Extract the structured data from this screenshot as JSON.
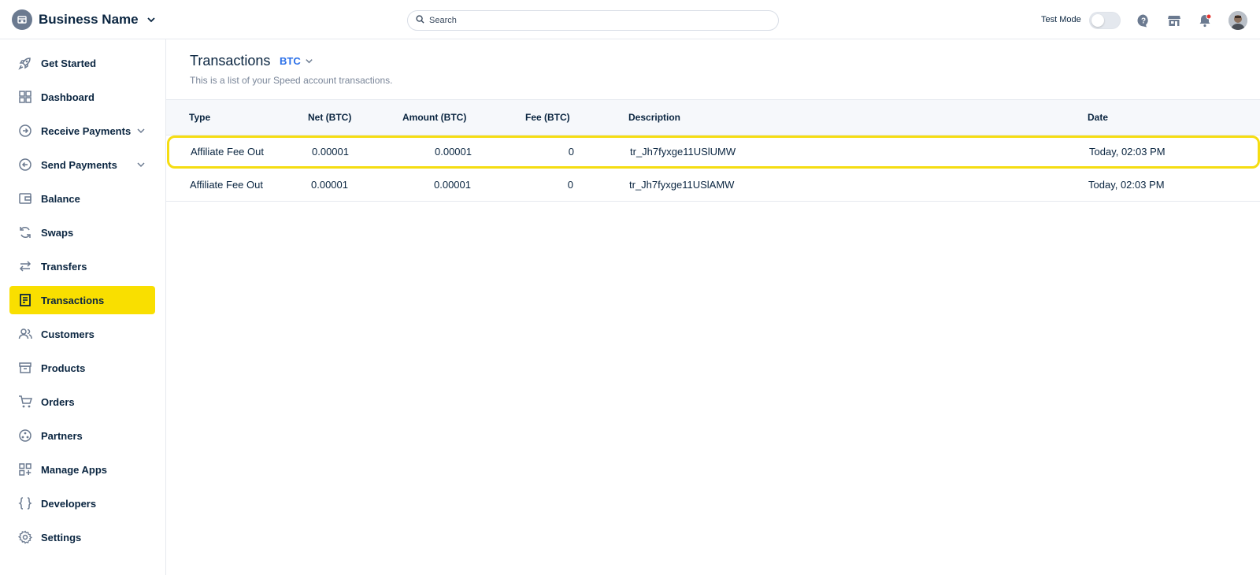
{
  "header": {
    "business_name": "Business Name",
    "search_placeholder": "Search",
    "test_mode_label": "Test Mode",
    "test_mode_on": false,
    "icons": [
      "help-icon",
      "store-icon",
      "notification-bell-icon"
    ]
  },
  "sidebar": {
    "items": [
      {
        "label": "Get Started",
        "icon": "rocket-icon"
      },
      {
        "label": "Dashboard",
        "icon": "grid-icon"
      },
      {
        "label": "Receive Payments",
        "icon": "receive-arrow-icon",
        "expandable": true
      },
      {
        "label": "Send Payments",
        "icon": "send-arrow-icon",
        "expandable": true
      },
      {
        "label": "Balance",
        "icon": "wallet-icon"
      },
      {
        "label": "Swaps",
        "icon": "swap-icon"
      },
      {
        "label": "Transfers",
        "icon": "transfer-arrows-icon"
      },
      {
        "label": "Transactions",
        "icon": "receipt-icon",
        "active": true
      },
      {
        "label": "Customers",
        "icon": "users-icon"
      },
      {
        "label": "Products",
        "icon": "archive-box-icon"
      },
      {
        "label": "Orders",
        "icon": "cart-icon"
      },
      {
        "label": "Partners",
        "icon": "partners-icon"
      },
      {
        "label": "Manage Apps",
        "icon": "apps-plus-icon"
      },
      {
        "label": "Developers",
        "icon": "code-braces-icon"
      },
      {
        "label": "Settings",
        "icon": "gear-icon"
      }
    ]
  },
  "main": {
    "title": "Transactions",
    "currency": "BTC",
    "subtitle": "This is a list of your Speed account transactions.",
    "table": {
      "columns": [
        "Type",
        "Net (BTC)",
        "Amount  (BTC)",
        "Fee  (BTC)",
        "Description",
        "Date"
      ],
      "rows": [
        {
          "type": "Affiliate Fee Out",
          "net": "0.00001",
          "amount": "0.00001",
          "fee": "0",
          "description": "tr_Jh7fyxge11USlUMW",
          "date": "Today, 02:03 PM",
          "highlighted": true
        },
        {
          "type": "Affiliate Fee Out",
          "net": "0.00001",
          "amount": "0.00001",
          "fee": "0",
          "description": "tr_Jh7fyxge11USlAMW",
          "date": "Today, 02:03 PM",
          "highlighted": false
        }
      ]
    }
  },
  "colors": {
    "active_nav": "#f9df00",
    "highlight_border": "#f5dd12",
    "accent_blue": "#2a6fe8",
    "text_primary": "#0a2540",
    "notification_dot": "#e5342f"
  }
}
